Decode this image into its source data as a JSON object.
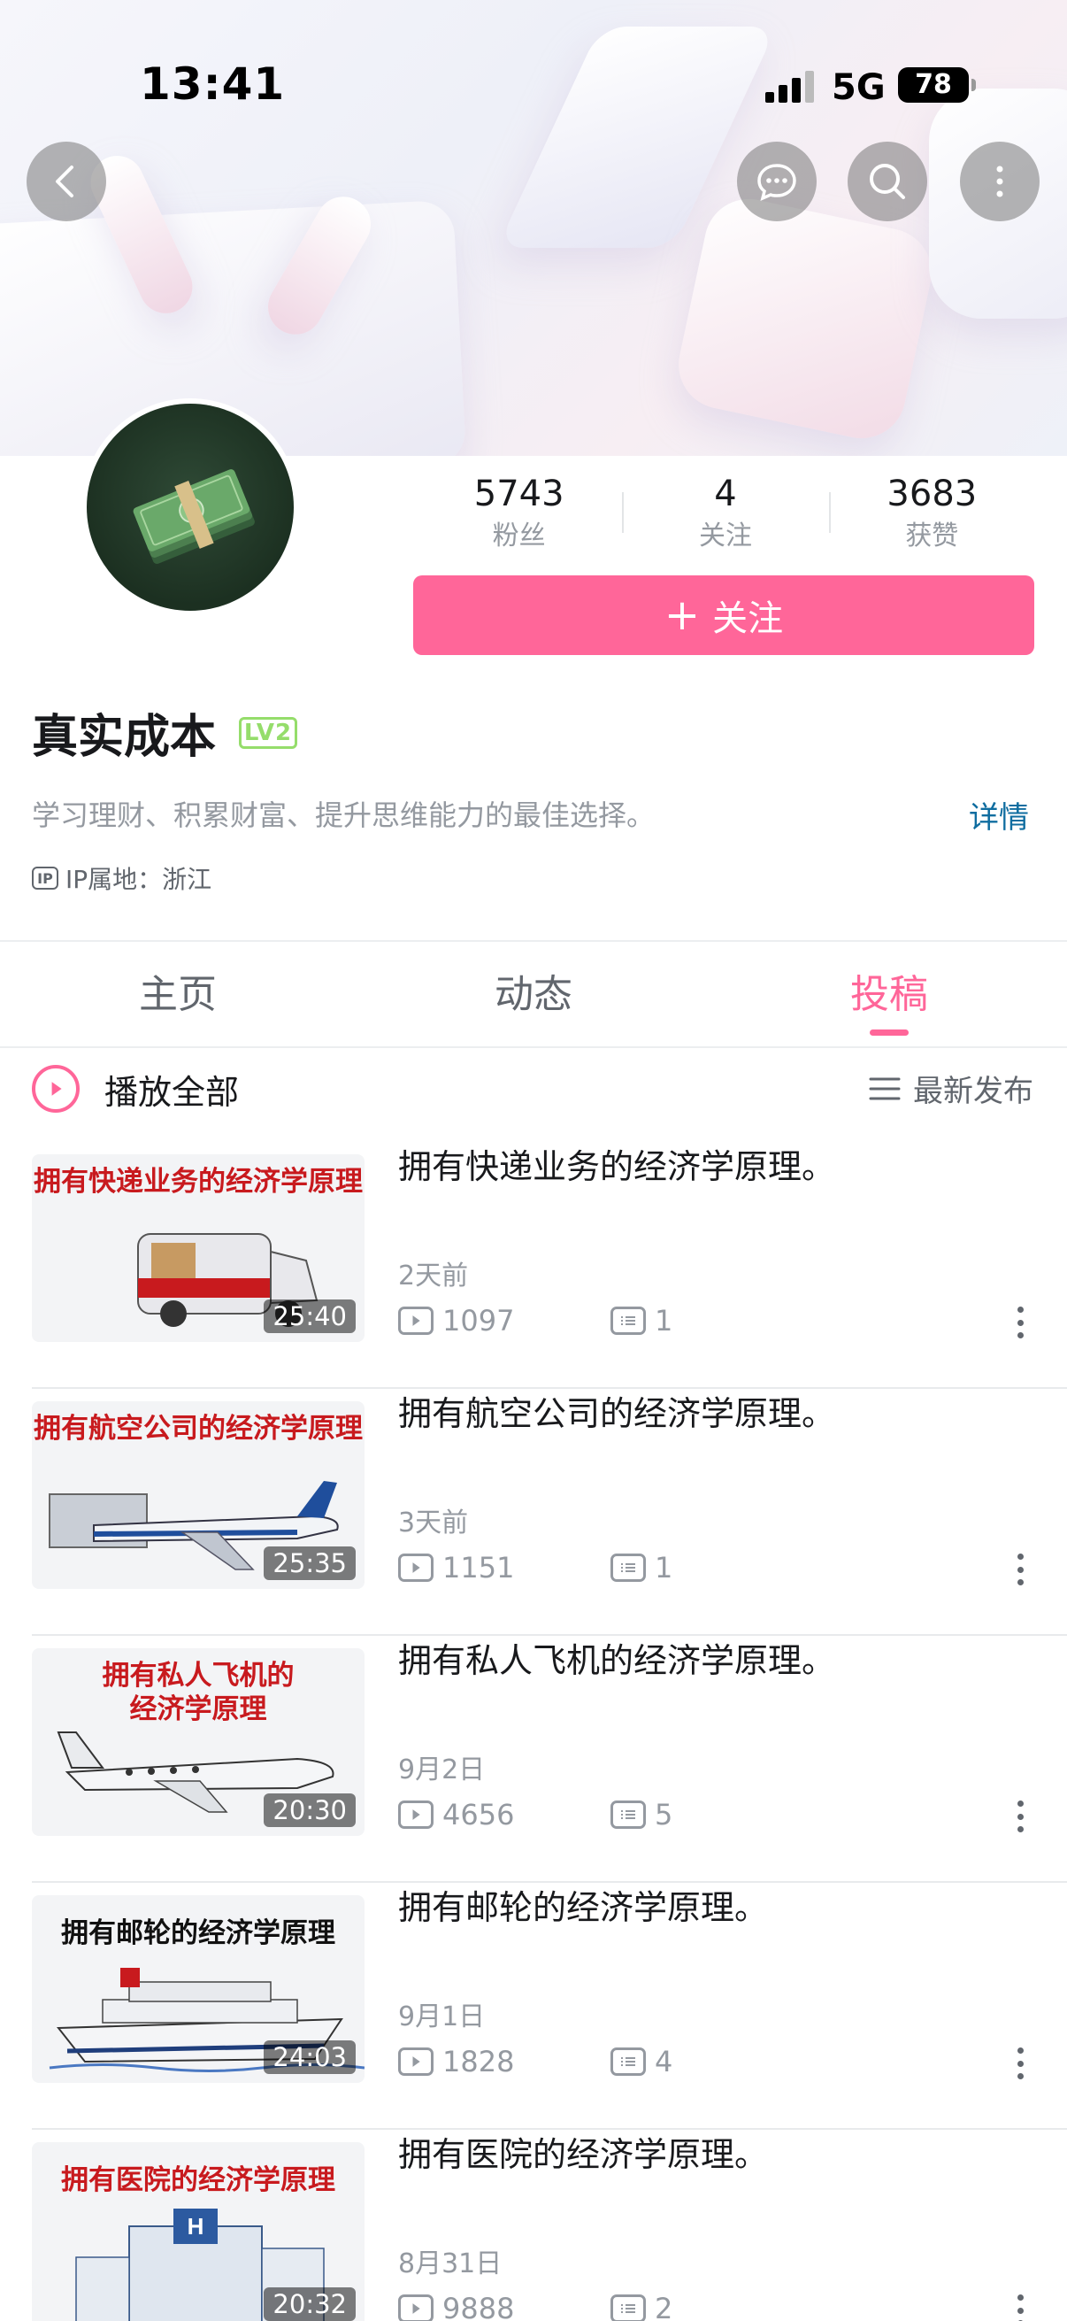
{
  "status_bar": {
    "time": "13:41",
    "network": "5G",
    "battery": "78"
  },
  "profile": {
    "fans_count": "5743",
    "fans_label": "粉丝",
    "following_count": "4",
    "following_label": "关注",
    "likes_count": "3683",
    "likes_label": "获赞",
    "follow_label": "关注",
    "name": "真实成本",
    "level": "LV2",
    "bio": "学习理财、积累财富、提升思维能力的最佳选择。",
    "detail_label": "详情",
    "ip_icon": "IP",
    "ip_location": "IP属地：浙江"
  },
  "tabs": [
    {
      "label": "主页"
    },
    {
      "label": "动态"
    },
    {
      "label": "投稿"
    }
  ],
  "active_tab": "投稿",
  "list_header": {
    "play_all": "播放全部",
    "sort": "最新发布"
  },
  "videos": [
    {
      "thumb_title": "拥有快递业务的经济学原理",
      "duration": "25:40",
      "title": "拥有快递业务的经济学原理。",
      "date": "2天前",
      "plays": "1097",
      "comments": "1"
    },
    {
      "thumb_title": "拥有航空公司的经济学原理",
      "duration": "25:35",
      "title": "拥有航空公司的经济学原理。",
      "date": "3天前",
      "plays": "1151",
      "comments": "1"
    },
    {
      "thumb_title": "拥有私人飞机的\n经济学原理",
      "duration": "20:30",
      "title": "拥有私人飞机的经济学原理。",
      "date": "9月2日",
      "plays": "4656",
      "comments": "5"
    },
    {
      "thumb_title": "拥有邮轮的经济学原理",
      "duration": "24:03",
      "title": "拥有邮轮的经济学原理。",
      "date": "9月1日",
      "plays": "1828",
      "comments": "4"
    },
    {
      "thumb_title": "拥有医院的经济学原理",
      "duration": "20:32",
      "title": "拥有医院的经济学原理。",
      "date": "8月31日",
      "plays": "9888",
      "comments": "2"
    }
  ],
  "colors": {
    "accent": "#ff6699",
    "link": "#0f6da0",
    "level": "#95dd6b",
    "thumb_title": "#c81a1e"
  }
}
